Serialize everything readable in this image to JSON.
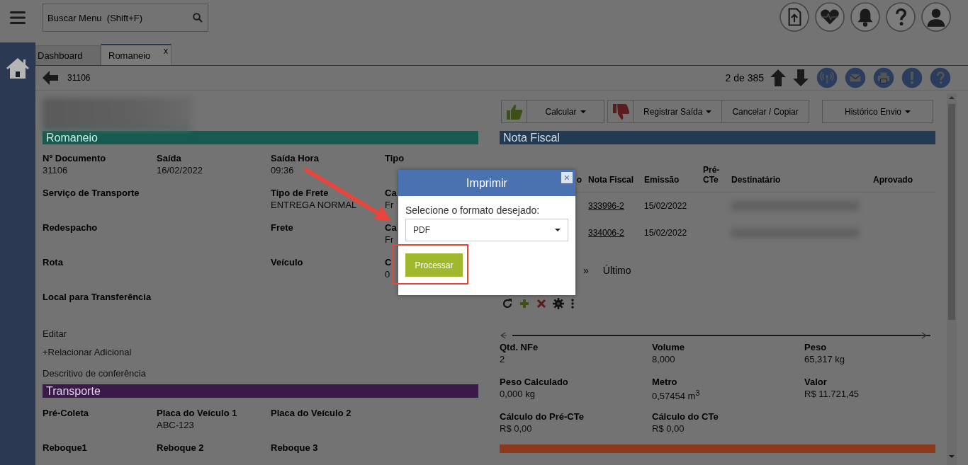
{
  "top_bar": {
    "search": {
      "placeholder": "Buscar Menu  (Shift+F)"
    }
  },
  "tabs": [
    {
      "label": "Dashboard",
      "selected": false
    },
    {
      "label": "Romaneio",
      "selected": true,
      "close": "x"
    }
  ],
  "record_bar": {
    "number": "31106",
    "position": "2 de 385"
  },
  "romaneio": {
    "title": "Romaneio",
    "rows": [
      [
        {
          "label": "Nº Documento",
          "value": "31106"
        },
        {
          "label": "Saída",
          "value": "16/02/2022"
        },
        {
          "label": "Saída Hora",
          "value": "09:36"
        },
        {
          "label": "Tipo"
        }
      ],
      [
        {
          "label": "Serviço de Transporte"
        },
        "",
        {
          "label": "Tipo de Frete",
          "value": "ENTREGA NORMAL"
        },
        {
          "label": "Ca",
          "value": "Fr"
        }
      ],
      [
        {
          "label": "Redespacho"
        },
        "",
        {
          "label": "Frete"
        },
        {
          "label": "Ca",
          "value": "Fr"
        }
      ],
      [
        {
          "label": "Rota"
        },
        "",
        {
          "label": "Veículo"
        },
        {
          "label": "C",
          "value": "0"
        }
      ],
      [
        {
          "label": "Local para Transferência"
        }
      ]
    ],
    "links": [
      "Editar",
      "+Relacionar Adicional",
      "Descritivo de conferência"
    ]
  },
  "transporte": {
    "title": "Transporte",
    "rows": [
      [
        {
          "label": "Pré-Coleta"
        },
        {
          "label": "Placa do Veículo 1",
          "value": "ABC-123"
        },
        {
          "label": "Placa do Veículo 2"
        }
      ],
      [
        {
          "label": "Reboque1"
        },
        {
          "label": "Reboque 2"
        },
        {
          "label": "Reboque 3"
        }
      ]
    ]
  },
  "actions": [
    [
      {
        "kind": "approve"
      },
      {
        "kind": "menu",
        "label": "Calcular"
      }
    ],
    [
      {
        "kind": "reject"
      },
      {
        "kind": "menu",
        "label": "Registrar Saída"
      },
      {
        "kind": "plain",
        "label": "Cancelar / Copiar"
      }
    ],
    [
      {
        "kind": "menu",
        "label": "Histórico Envio"
      }
    ]
  ],
  "nota_fiscal": {
    "title": "Nota Fiscal",
    "columns": [
      "o",
      "Nota Fiscal",
      "Emissão",
      "Pré-CTe",
      "Destinatário",
      "Aprovado"
    ],
    "rows": [
      {
        "nota_fiscal": "333996-2",
        "emissao": "15/02/2022"
      },
      {
        "nota_fiscal": "334006-2",
        "emissao": "15/02/2022"
      }
    ],
    "pager": [
      "»",
      "Último"
    ]
  },
  "totals": [
    {
      "label": "Qtd. NFe",
      "value": "2"
    },
    {
      "label": "Volume",
      "value": "8,000"
    },
    {
      "label": "Peso",
      "value": "65,317 kg"
    },
    {
      "label": "Peso Calculado",
      "value": "0,000 kg"
    },
    {
      "label": "Metro",
      "value": "0,57454 m$^{3}$"
    },
    {
      "label": "Valor",
      "value": "R$ 11.721,45"
    },
    {
      "label": "Cálculo do Pré-CTe",
      "value": "R$ 0,00"
    },
    {
      "label": "Cálculo do CTe",
      "value": "R$ 0,00"
    }
  ],
  "dialog": {
    "title": "Imprimir",
    "close": "×",
    "label": "Selecione o formato desejado:",
    "format": "PDF",
    "button": "Processar"
  }
}
